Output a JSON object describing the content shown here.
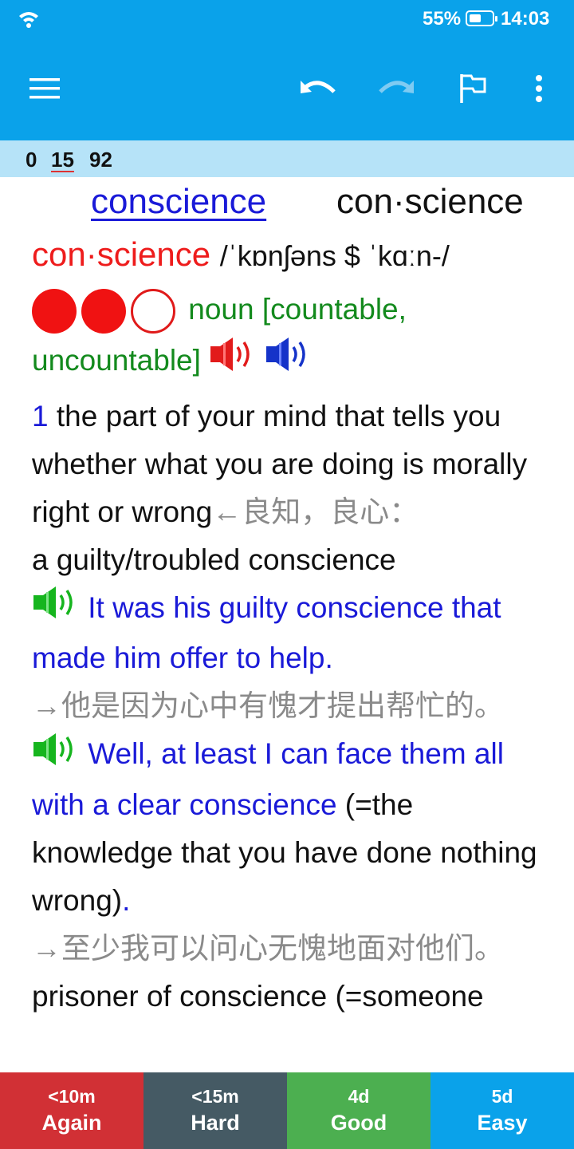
{
  "status": {
    "battery": "55%",
    "time": "14:03",
    "icons": [
      "wifi-icon",
      "battery-icon"
    ]
  },
  "toolbar": {
    "icons": [
      "menu-icon",
      "undo-icon",
      "redo-icon",
      "flag-icon",
      "more-vert-icon"
    ]
  },
  "counts": {
    "new": "0",
    "learning": "15",
    "review": "92"
  },
  "card": {
    "headword": "conscience",
    "syllables": "con·science",
    "headword_red": "con·science",
    "pronunciation": "/ˈkɒnʃəns $ ˈkɑːn-/",
    "frequency": {
      "filled": 2,
      "total": 3
    },
    "pos": "noun [countable, uncountable]",
    "sense_number": "1",
    "definition": "the part of your mind that tells you whether what you are doing is morally right or wrong",
    "definition_cn": "←良知，良心：",
    "collocation": "a guilty/troubled conscience",
    "example1": "It was his guilty conscience that made him offer to help.",
    "example1_cn": "→他是因为心中有愧才提出帮忙的。",
    "example2": "Well, at least I can face them all with a clear conscience",
    "example2_gloss": " (=the knowledge that you have done nothing wrong)",
    "example2_dot": ".",
    "example2_cn": "→至少我可以问心无愧地面对他们。",
    "phrase": "prisoner of conscience (=someone"
  },
  "answers": [
    {
      "interval": "<10m",
      "label": "Again",
      "color": "#d13035"
    },
    {
      "interval": "<15m",
      "label": "Hard",
      "color": "#455a64"
    },
    {
      "interval": "4d",
      "label": "Good",
      "color": "#4caf50"
    },
    {
      "interval": "5d",
      "label": "Easy",
      "color": "#0aa2ea"
    }
  ]
}
